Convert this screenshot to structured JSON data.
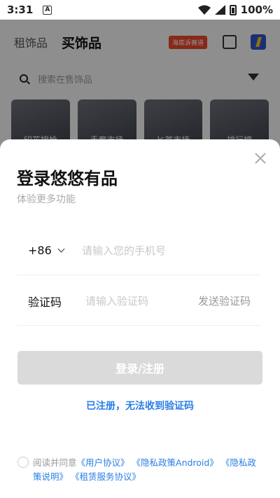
{
  "status_bar": {
    "time": "3:31",
    "notification_glyph": "A",
    "battery": "100%"
  },
  "background": {
    "tabs": [
      "租饰品",
      "买饰品"
    ],
    "badge": "海底诉赛道",
    "search_placeholder": "搜索在售饰品",
    "cards": [
      "印花搜枪",
      "手套市场",
      "匕首市场",
      "排行榜"
    ]
  },
  "login": {
    "title": "登录悠悠有品",
    "subtitle": "体验更多功能",
    "country_code": "+86",
    "phone_placeholder": "请输入您的手机号",
    "code_label": "验证码",
    "code_placeholder": "请输入验证码",
    "send_code": "发送验证码",
    "submit": "登录/注册",
    "cant_receive": "已注册，无法收到验证码",
    "agreement_prefix": "阅读并同意",
    "agreement_links": [
      "《用户协议》",
      "《隐私政策Android》",
      "《隐私政策说明》",
      "《租赁服务协议》"
    ]
  },
  "colors": {
    "link": "#2a7ee6",
    "button_disabled": "#dadada",
    "badge": "#e8452a"
  }
}
